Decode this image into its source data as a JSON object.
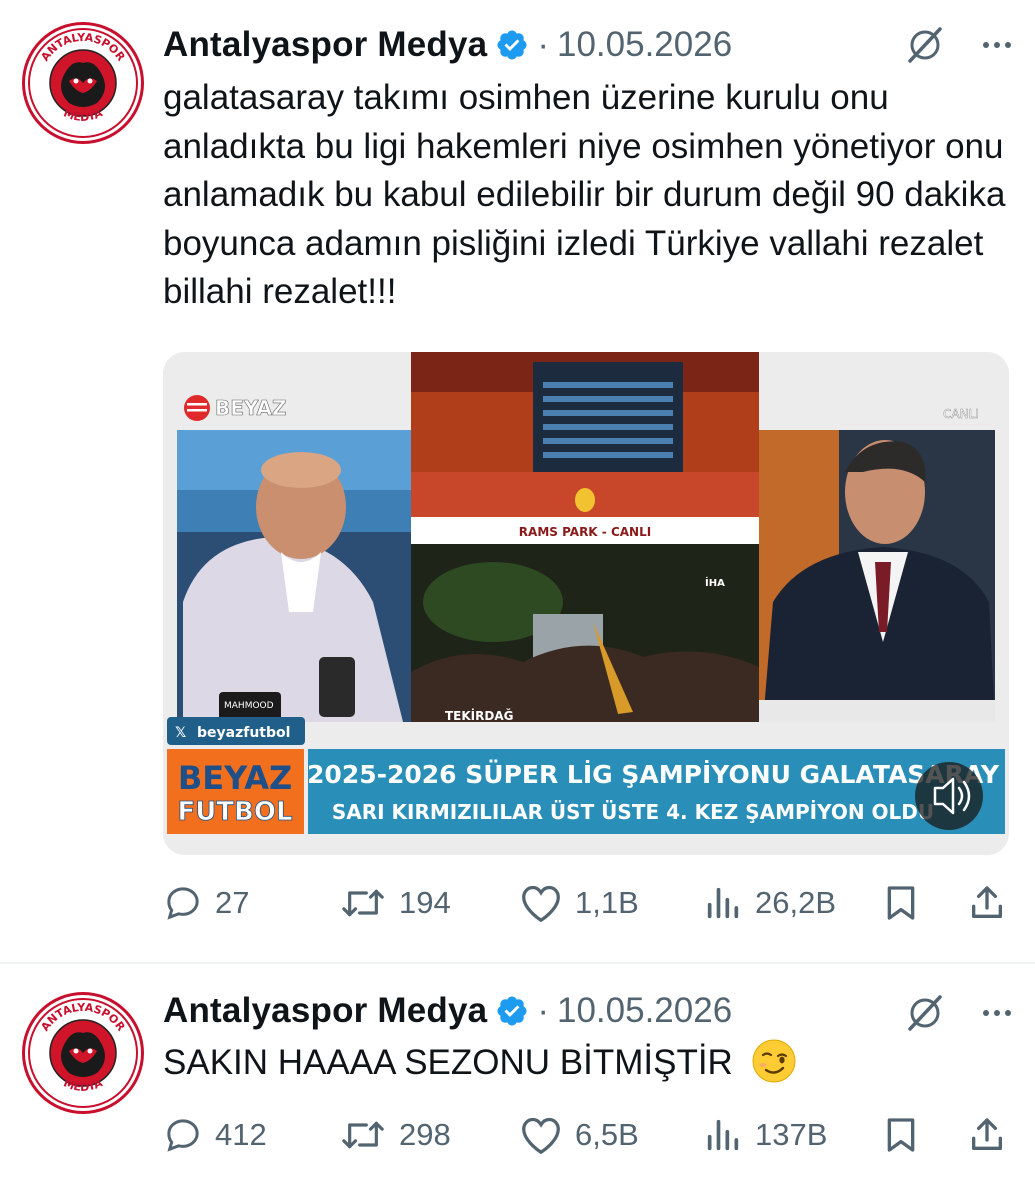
{
  "tweets": [
    {
      "author": "Antalyaspor Medya",
      "avatar_text": "ANTALYASPOR MEDYA",
      "dot": "·",
      "date": "10.05.2026",
      "text": "galatasaray takımı osimhen üzerine kurulu onu anladıkta bu ligi hakemleri niye osimhen yönetiyor onu anlamadık bu kabul edilebilir bir durum değil 90 dakika boyunca adamın pisliğini izledi Türkiye vallahi rezalet billahi rezalet!!!",
      "media": {
        "logo": "BEYAZ",
        "live_tag": "CANLI",
        "top_caption": "RAMS PARK - CANLI",
        "bottom_caption": "TEKİRDAĞ",
        "agency_tag": "İHA",
        "mug_text": "MAHMOOD",
        "social_handle": "beyazfutbol",
        "brand_top": "BEYAZ",
        "brand_bottom": "FUTBOL",
        "headline": "2025-2026 SÜPER LİG ŞAMPİYONU GALATASARAY",
        "subheadline": "SARI KIRMIZILILAR ÜST ÜSTE 4. KEZ ŞAMPİYON OLDU"
      },
      "stats": {
        "replies": "27",
        "reposts": "194",
        "likes": "1,1B",
        "views": "26,2B"
      }
    },
    {
      "author": "Antalyaspor Medya",
      "avatar_text": "ANTALYASPOR MEDYA",
      "dot": "·",
      "date": "10.05.2026",
      "text": "SAKIN HAAAA SEZONU BİTMİŞTİR",
      "stats": {
        "replies": "412",
        "reposts": "298",
        "likes": "6,5B",
        "views": "137B"
      }
    }
  ],
  "icons": {
    "verified": "verified-badge-icon",
    "grok": "grok-icon",
    "more": "more-icon",
    "reply": "reply-icon",
    "repost": "repost-icon",
    "like": "like-icon",
    "views": "views-icon",
    "bookmark": "bookmark-icon",
    "share": "share-icon",
    "emoji": "winking-face-icon",
    "mute": "speaker-icon"
  },
  "colors": {
    "text": "#0f1419",
    "secondary": "#536471",
    "verified": "#1d9bf0",
    "avatar_red": "#c8102e",
    "banner_blue": "#2a8fb8",
    "banner_orange": "#f2701d"
  }
}
